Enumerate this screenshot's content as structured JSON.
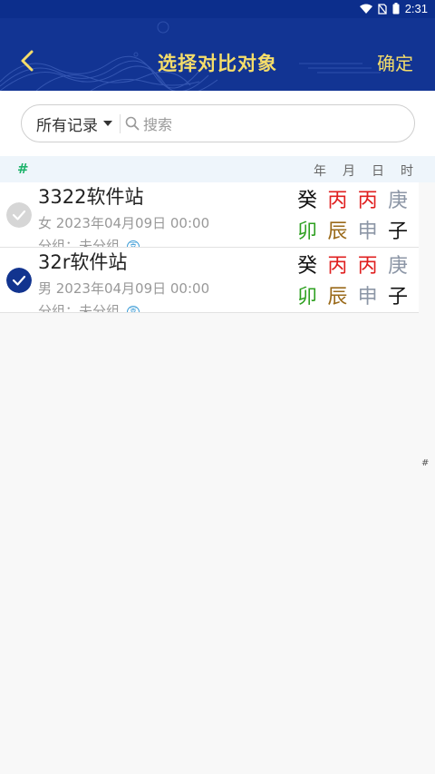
{
  "status_bar": {
    "time": "2:31"
  },
  "header": {
    "back_label": "",
    "title": "选择对比对象",
    "confirm_label": "确定"
  },
  "search": {
    "filter_label": "所有记录",
    "placeholder": "搜索"
  },
  "list_header": {
    "index": "#",
    "columns": [
      "年",
      "月",
      "日",
      "时"
    ]
  },
  "records": [
    {
      "name": "3322软件站",
      "meta": "女 2023年04月09日 00:00",
      "group": "分组：未分组",
      "badge": "喜",
      "selected": false,
      "stems": [
        "癸",
        "丙",
        "丙",
        "庚"
      ],
      "branches": [
        "卯",
        "辰",
        "申",
        "子"
      ]
    },
    {
      "name": "32r软件站",
      "meta": "男 2023年04月09日 00:00",
      "group": "分组：未分组",
      "badge": "喜",
      "selected": true,
      "stems": [
        "癸",
        "丙",
        "丙",
        "庚"
      ],
      "branches": [
        "卯",
        "辰",
        "申",
        "子"
      ]
    }
  ],
  "colors": {
    "stems": [
      "#111111",
      "#e02020",
      "#e02020",
      "#8c96a6"
    ],
    "branches": [
      "#2ea020",
      "#9a6a1a",
      "#8c96a6",
      "#111111"
    ],
    "accent_yellow": "#f5dd6a",
    "header_blue": "#123493"
  },
  "index_bar": {
    "label": "#"
  }
}
